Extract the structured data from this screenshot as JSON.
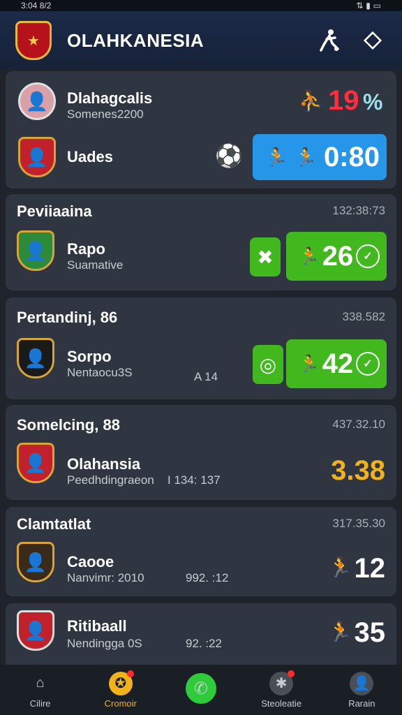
{
  "status": {
    "time": "3:04 8/2",
    "icons": "⇅ ▮ ▭"
  },
  "app": {
    "title": "OLAHKANESIA",
    "logo_color": "#b5121b"
  },
  "cards": [
    {
      "name1": "Dlahagcalis",
      "sub1": "Somenes2200",
      "score1": "19",
      "score1_suffix": "%",
      "score1_color": "#ff2d3d",
      "name2": "Uades",
      "score2": "0:80"
    },
    {
      "league": "Peviiaaina",
      "time": "132:38:73",
      "team": "Rapo",
      "sub": "Suamative",
      "score": "26"
    },
    {
      "league": "Pertandinj, 86",
      "time": "338.582",
      "team": "Sorpo",
      "sub": "Nentaocu3S",
      "extra": "A  14",
      "score": "42"
    },
    {
      "league": "Somelcing, 88",
      "time": "437.32.10",
      "team": "Olahansia",
      "sub": "Peedhdingraeon",
      "sub_extra": "I 134: 137",
      "score": "3.38",
      "score_color": "#f1b21a"
    },
    {
      "league": "Clamtatlat",
      "time": "317.35.30",
      "team": "Caooe",
      "sub": "Nanvimr: 2010",
      "sub_extra": "992. :12",
      "score": "12"
    },
    {
      "team": "Ritibaall",
      "sub": "Nendingga 0S",
      "sub_extra": "92. :22",
      "score": "35"
    }
  ],
  "nav": [
    {
      "label": "Cilire",
      "icon": "home-icon"
    },
    {
      "label": "Cromoir",
      "icon": "whistle-icon",
      "badge": true
    },
    {
      "label": "",
      "icon": "phone-icon"
    },
    {
      "label": "Steoleatie",
      "icon": "settings-icon",
      "badge": true
    },
    {
      "label": "Rarain",
      "icon": "profile-icon"
    }
  ]
}
